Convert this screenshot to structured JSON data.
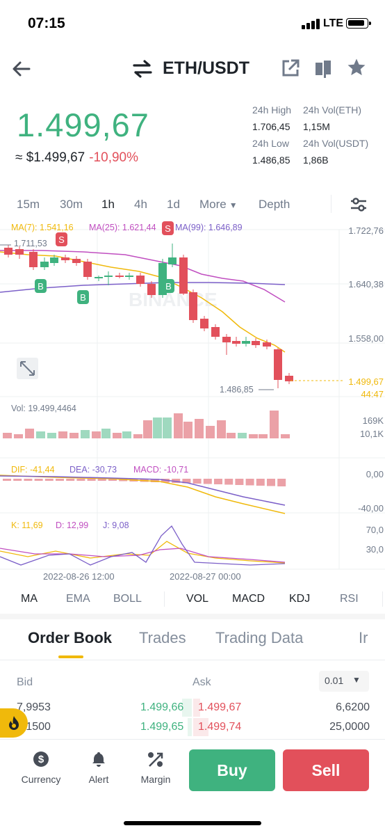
{
  "status_bar": {
    "time": "07:15",
    "network": "LTE"
  },
  "header": {
    "pair": "ETH/USDT"
  },
  "ticker": {
    "last_price": "1.499,67",
    "approx_usd": "≈ $1.499,67",
    "change": "-10,90%",
    "stats": [
      {
        "label": "24h High",
        "value": "1.706,45"
      },
      {
        "label": "24h Vol(ETH)",
        "value": "1,15M"
      },
      {
        "label": "24h Low",
        "value": "1.486,85"
      },
      {
        "label": "24h Vol(USDT)",
        "value": "1,86B"
      }
    ]
  },
  "timeframes": {
    "items": [
      "15m",
      "30m",
      "1h",
      "4h",
      "1d",
      "More",
      "Depth"
    ],
    "active": "1h"
  },
  "chart": {
    "ma_legend": {
      "ma7": "MA(7): 1.541,16",
      "ma25": "MA(25): 1.621,44",
      "ma99": "MA(99): 1.646,89"
    },
    "price_axis": [
      "1.722,76",
      "1.640,38",
      "1.558,00"
    ],
    "current_price_tag": "1.499,67",
    "countdown": "44:47",
    "high_marker": "1.711,53",
    "low_marker": "1.486,85",
    "watermark": "BINANCE",
    "vol_legend": "Vol: 19.499,4464",
    "vol_axis": [
      "169K",
      "10,1K"
    ],
    "macd_legend": {
      "dif": "DIF: -41,44",
      "dea": "DEA: -30,73",
      "macd": "MACD: -10,71"
    },
    "macd_axis": [
      "0,00",
      "-40,00"
    ],
    "kdj_legend": {
      "k": "K: 11,69",
      "d": "D: 12,99",
      "j": "J: 9,08"
    },
    "kdj_axis": [
      "70,0",
      "30,0"
    ],
    "time_axis": [
      "2022-08-26 12:00",
      "2022-08-27 00:00"
    ],
    "trade_markers": [
      "S",
      "S",
      "B",
      "B",
      "B"
    ],
    "colors": {
      "up": "#3fb27f",
      "down": "#e2505b",
      "ma7": "#f0b90b",
      "ma25": "#c04ec0",
      "ma99": "#7b5fc8"
    }
  },
  "indicators": {
    "main": [
      "MA",
      "EMA",
      "BOLL"
    ],
    "sub": [
      "VOL",
      "MACD",
      "KDJ",
      "RSI"
    ]
  },
  "tabs": [
    "Order Book",
    "Trades",
    "Trading Data",
    "Ir"
  ],
  "order_book": {
    "bid_label": "Bid",
    "ask_label": "Ask",
    "precision": "0.01",
    "rows": [
      {
        "bid_qty": "7,9953",
        "bid_price": "1.499,66",
        "ask_price": "1.499,67",
        "ask_qty": "6,6200"
      },
      {
        "bid_qty": "1,1500",
        "bid_price": "1.499,65",
        "ask_price": "1.499,74",
        "ask_qty": "25,0000"
      }
    ]
  },
  "bottom_bar": {
    "items": [
      "Currency",
      "Alert",
      "Margin"
    ],
    "buy": "Buy",
    "sell": "Sell"
  }
}
